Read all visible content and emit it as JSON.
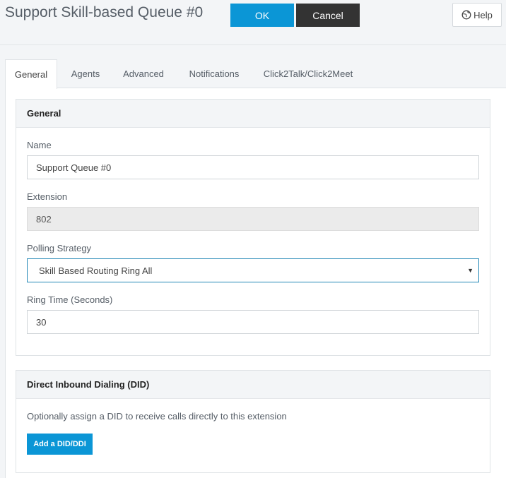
{
  "header": {
    "title": "Support Skill-based Queue #0",
    "ok_label": "OK",
    "cancel_label": "Cancel",
    "help_label": "Help",
    "help_icon": "globe-icon"
  },
  "tabs": [
    {
      "label": "General",
      "active": true
    },
    {
      "label": "Agents",
      "active": false
    },
    {
      "label": "Advanced",
      "active": false
    },
    {
      "label": "Notifications",
      "active": false
    },
    {
      "label": "Click2Talk/Click2Meet",
      "active": false
    }
  ],
  "general_panel": {
    "heading": "General",
    "name_label": "Name",
    "name_value": "Support Queue #0",
    "extension_label": "Extension",
    "extension_value": "802",
    "polling_label": "Polling Strategy",
    "polling_value": "Skill Based Routing Ring All",
    "ring_time_label": "Ring Time (Seconds)",
    "ring_time_value": "30"
  },
  "did_panel": {
    "heading": "Direct Inbound Dialing (DID)",
    "description": "Optionally assign a DID to receive calls directly to this extension",
    "add_button_label": "Add a DID/DDI"
  },
  "colors": {
    "primary": "#0b96d6",
    "dark_button": "#333333",
    "background": "#f3f5f7"
  }
}
